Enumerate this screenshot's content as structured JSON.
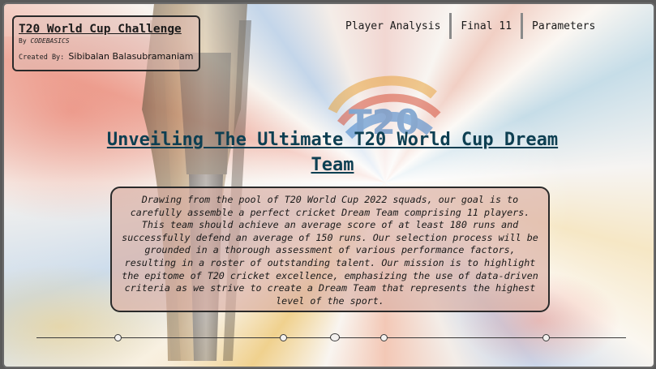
{
  "header": {
    "title": "T20 World Cup Challenge",
    "by_label": "By ",
    "by_value": "CODEBASICS",
    "created_label": "Created By: ",
    "created_value": "Sibibalan Balasubramaniam"
  },
  "nav": {
    "items": [
      {
        "label": "Player Analysis"
      },
      {
        "label": "Final 11"
      },
      {
        "label": "Parameters"
      }
    ]
  },
  "main": {
    "headline": "Unveiling The Ultimate T20 World Cup Dream Team",
    "description": "Drawing from the pool of T20 World Cup 2022 squads, our goal is to carefully assemble a perfect cricket Dream Team comprising 11 players. This team should achieve an average score of at least 180 runs and successfully defend an average of 150 runs. Our selection process will be grounded in a thorough assessment of various performance factors, resulting in a roster of outstanding talent. Our mission is to highlight the epitome of T20 cricket excellence, emphasizing the use of data-driven criteria as we strive to create a Dream Team that represents the highest level of the sport."
  },
  "timeline": {
    "selected_index": 2,
    "dot_count": 5
  },
  "colors": {
    "headline": "#0d3f52",
    "card_fill": "#dab0a4"
  }
}
